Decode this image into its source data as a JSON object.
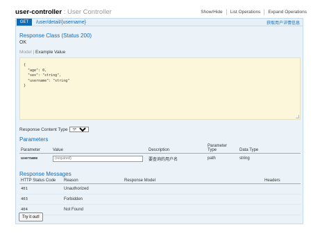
{
  "controller": {
    "name": "user-controller",
    "separator": ":",
    "description": "User Controller",
    "links": [
      "Show/Hide",
      "List Operations",
      "Expand Operations"
    ]
  },
  "operation": {
    "method": "GET",
    "path": "/user/detail/{username}",
    "summary": "获取用户详情信息"
  },
  "response_class": {
    "title": "Response Class (Status 200)",
    "status": "OK",
    "model_label": "Model",
    "model_sep": "|",
    "example_label": "Example Value",
    "example_json": "{\n  \"age\": 0,\n  \"sex\": \"string\",\n  \"username\": \"string\"\n}"
  },
  "content_type": {
    "label": "Response Content Type",
    "selected": "*/*"
  },
  "parameters": {
    "title": "Parameters",
    "headers": [
      "Parameter",
      "Value",
      "Description",
      "Parameter Type",
      "Data Type"
    ],
    "rows": [
      {
        "name": "username",
        "placeholder": "(required)",
        "description": "要查询的用户名",
        "param_type": "path",
        "data_type": "string"
      }
    ]
  },
  "response_messages": {
    "title": "Response Messages",
    "headers": [
      "HTTP Status Code",
      "Reason",
      "Response Model",
      "Headers"
    ],
    "rows": [
      {
        "code": "401",
        "reason": "Unauthorized"
      },
      {
        "code": "403",
        "reason": "Forbidden"
      },
      {
        "code": "404",
        "reason": "Not Found"
      }
    ]
  },
  "try_button": "Try it out!"
}
